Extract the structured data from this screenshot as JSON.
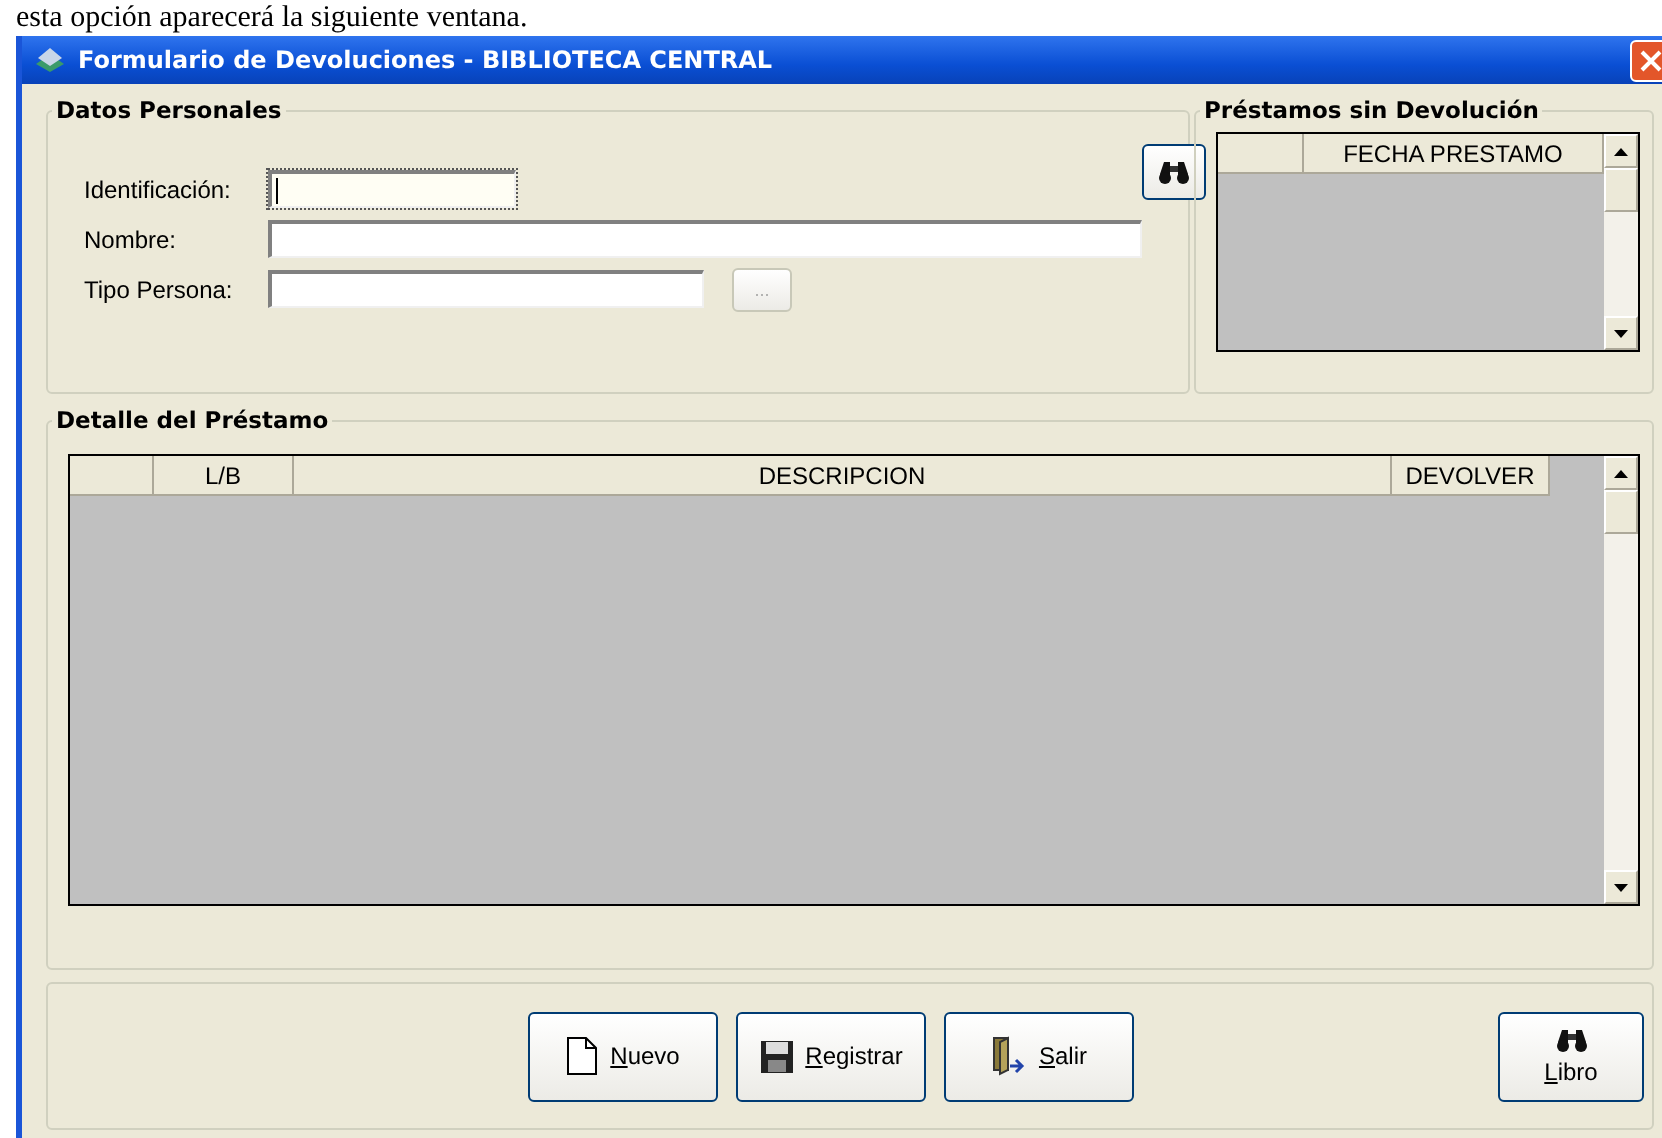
{
  "document_text": "esta opción aparecerá la siguiente ventana.",
  "window": {
    "title": "Formulario de Devoluciones - BIBLIOTECA CENTRAL"
  },
  "datos_personales": {
    "title": "Datos Personales",
    "fields": [
      {
        "label": "Identificación:",
        "focused": true
      },
      {
        "label": "Nombre:",
        "focused": false
      },
      {
        "label": "Tipo Persona:",
        "focused": false
      }
    ],
    "browse_button": {
      "label": "...",
      "disabled": true
    }
  },
  "prestamos": {
    "title": "Préstamos sin Devolución",
    "columns": [
      "FECHA PRESTAMO"
    ]
  },
  "detalle": {
    "title": "Detalle del Préstamo",
    "columns": [
      "L/B",
      "DESCRIPCION",
      "DEVOLVER"
    ]
  },
  "buttons": [
    {
      "kind": "new",
      "label": "Nuevo",
      "underline_first": true
    },
    {
      "kind": "save",
      "label": "Registrar",
      "underline_first": true
    },
    {
      "kind": "exit",
      "label": "Salir",
      "underline_first": true
    }
  ],
  "libro_button": {
    "label": "Libro",
    "underline_first": true
  }
}
